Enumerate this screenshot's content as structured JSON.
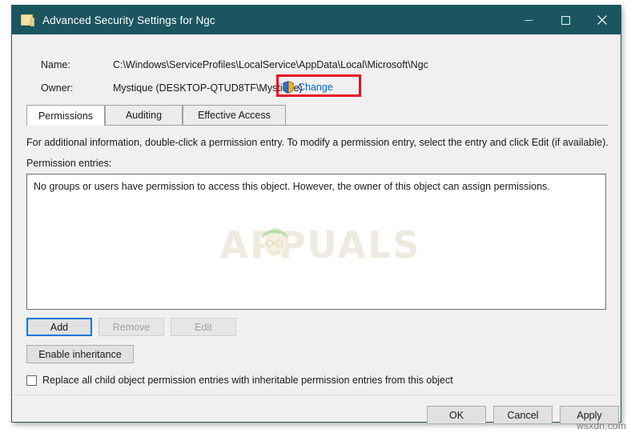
{
  "window": {
    "title": "Advanced Security Settings for Ngc",
    "icon": "folder-icon",
    "controls": {
      "minimize": "Minimize",
      "maximize": "Maximize",
      "close": "Close"
    },
    "colors": {
      "titlebar": "#1b5560",
      "accent_link": "#0066cc",
      "highlight": "#e81123",
      "focus": "#0078d7"
    }
  },
  "header": {
    "name_label": "Name:",
    "name_value": "C:\\Windows\\ServiceProfiles\\LocalService\\AppData\\Local\\Microsoft\\Ngc",
    "owner_label": "Owner:",
    "owner_value": "Mystique (DESKTOP-QTUD8TF\\Mystique)",
    "change_link": "Change",
    "change_icon": "uac-shield-icon"
  },
  "tabs": [
    {
      "label": "Permissions",
      "selected": true
    },
    {
      "label": "Auditing",
      "selected": false
    },
    {
      "label": "Effective Access",
      "selected": false
    }
  ],
  "main": {
    "info_text": "For additional information, double-click a permission entry. To modify a permission entry, select the entry and click Edit (if available).",
    "entries_label": "Permission entries:",
    "listbox_message": "No groups or users have permission to access this object. However, the owner of this object can assign permissions.",
    "watermark": "APPUALS"
  },
  "buttons": {
    "add": {
      "label": "Add",
      "enabled": true,
      "focused": true
    },
    "remove": {
      "label": "Remove",
      "enabled": false,
      "focused": false
    },
    "edit": {
      "label": "Edit",
      "enabled": false,
      "focused": false
    },
    "enable_inheritance": {
      "label": "Enable inheritance",
      "enabled": true,
      "focused": false
    }
  },
  "checkbox": {
    "label": "Replace all child object permission entries with inheritable permission entries from this object",
    "checked": false
  },
  "footer": {
    "ok": "OK",
    "cancel": "Cancel",
    "apply": "Apply"
  },
  "page_watermark": "wsxdn.com"
}
